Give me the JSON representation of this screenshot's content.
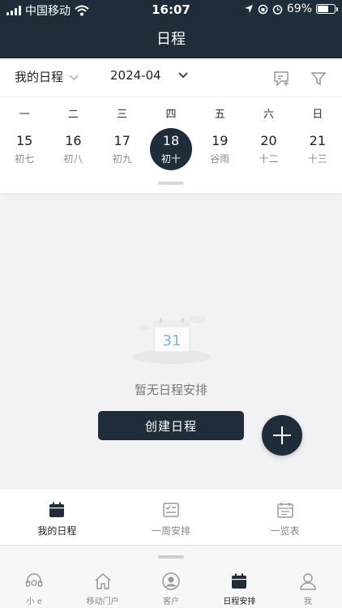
{
  "status_bar": {
    "carrier": "中国移动",
    "time": "16:07",
    "battery": "69%",
    "battery_level": 0.69
  },
  "header": {
    "title": "日程"
  },
  "toolbar": {
    "schedule_selector": "我的日程",
    "date_selector": "2024-04"
  },
  "week": {
    "weekdays": [
      "一",
      "二",
      "三",
      "四",
      "五",
      "六",
      "日"
    ],
    "days": [
      {
        "day": "15",
        "lunar": "初七",
        "selected": false
      },
      {
        "day": "16",
        "lunar": "初八",
        "selected": false
      },
      {
        "day": "17",
        "lunar": "初九",
        "selected": false
      },
      {
        "day": "18",
        "lunar": "初十",
        "selected": true
      },
      {
        "day": "19",
        "lunar": "谷雨",
        "selected": false
      },
      {
        "day": "20",
        "lunar": "十二",
        "selected": false
      },
      {
        "day": "21",
        "lunar": "十三",
        "selected": false
      }
    ]
  },
  "empty_state": {
    "calendar_number": "31",
    "message": "暂无日程安排",
    "create_button": "创建日程"
  },
  "sub_tabs": [
    {
      "label": "我的日程",
      "icon": "calendar-icon",
      "active": true
    },
    {
      "label": "一周安排",
      "icon": "week-checklist-icon",
      "active": false
    },
    {
      "label": "一览表",
      "icon": "calendar-list-icon",
      "active": false
    }
  ],
  "bottom_nav": [
    {
      "label": "小 e",
      "icon": "headset-icon",
      "active": false
    },
    {
      "label": "移动门户",
      "icon": "home-icon",
      "active": false
    },
    {
      "label": "客户",
      "icon": "customer-icon",
      "active": false
    },
    {
      "label": "日程安排",
      "icon": "calendar-icon",
      "active": true
    },
    {
      "label": "我",
      "icon": "user-icon",
      "active": false
    }
  ],
  "colors": {
    "primary": "#1f2d3a",
    "background": "#f2f2f4",
    "muted_text": "#888888"
  }
}
